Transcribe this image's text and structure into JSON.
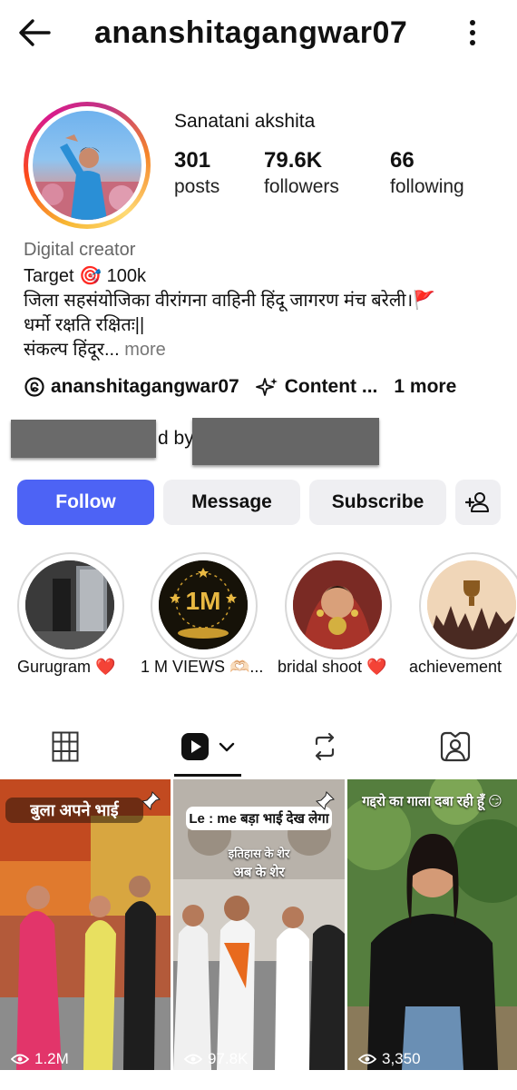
{
  "header": {
    "username": "ananshitagangwar07",
    "back_icon": "arrow-left-icon",
    "more_icon": "kebab-menu-icon"
  },
  "profile": {
    "display_name": "Sanatani akshita",
    "stats": [
      {
        "value": "301",
        "label": "posts"
      },
      {
        "value": "79.6K",
        "label": "followers"
      },
      {
        "value": "66",
        "label": "following"
      }
    ],
    "category": "Digital creator",
    "bio_line1": "Target 🎯 100k",
    "bio_line2": "जिला सहसंयोजिका वीरांगना वाहिनी हिंदू जागरण मंच बरेली।",
    "bio_line2_flag": "🚩",
    "bio_line3": "धर्मो रक्षति रक्षितः||",
    "bio_line4": "संकल्प हिंदूर...",
    "bio_more": " more",
    "threads_handle": "ananshitagangwar07",
    "content_label": "Content ...",
    "more_links": "1 more",
    "followed_by_fragment": "d by"
  },
  "actions": {
    "follow": "Follow",
    "message": "Message",
    "subscribe": "Subscribe",
    "add_user_icon": "add-person-icon"
  },
  "highlights": [
    {
      "label": "Gurugram ❤️"
    },
    {
      "label": "1 M VIEWS 🫶🏻..."
    },
    {
      "label": "bridal shoot ❤️"
    },
    {
      "label": "achievement"
    }
  ],
  "highlight_1m_text": "1M",
  "tabs": [
    "grid-icon",
    "reels-icon",
    "reposts-icon",
    "tagged-icon"
  ],
  "posts": [
    {
      "caption": "बुला अपने भाई",
      "views": "1.2M"
    },
    {
      "caption": "Le : me बड़ा भाई देख लेगा",
      "sub_caption_1": "इतिहास के शेर",
      "sub_caption_2": "अब के शेर",
      "views": "97.8K"
    },
    {
      "caption": "गद्दरो का गाला दबा रही हूँ 😏",
      "views": "3,350"
    }
  ],
  "colors": {
    "follow_button": "#4d63f5",
    "secondary_button": "#efeff2",
    "flag_red": "#e02020"
  }
}
